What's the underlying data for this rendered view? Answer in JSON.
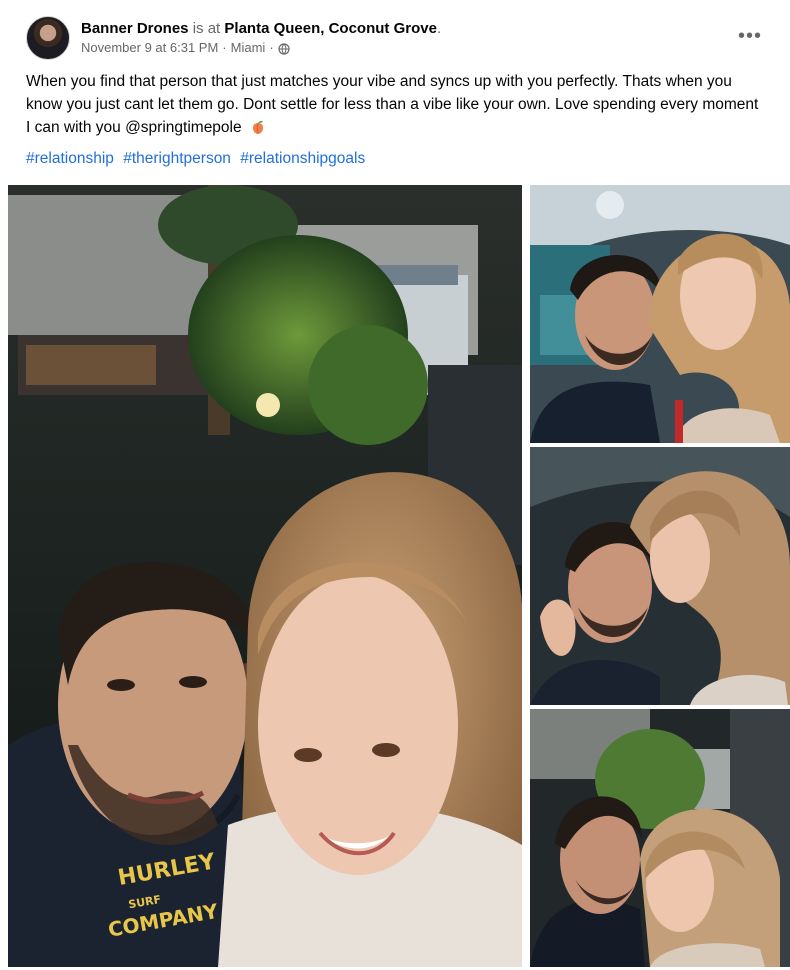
{
  "post": {
    "author": "Banner Drones",
    "is_at": "is at",
    "place": "Planta Queen, Coconut Grove",
    "period": ".",
    "timestamp": "November 9 at 6:31 PM",
    "separator": "·",
    "location": "Miami",
    "audience_icon": "globe-icon",
    "more_label": "•••",
    "text": "When you find that person that just matches your vibe and syncs up with you perfectly. Thats when you know you just cant let them go. Dont settle for less than a vibe like your own. Love spending every moment I can with you @springtimepole",
    "emoji": "peach-emoji",
    "hashtags": [
      "#relationship",
      "#therightperson",
      "#relationshipgoals"
    ],
    "shirt_text": [
      "HURLEY",
      "SURF",
      "COMPANY"
    ]
  },
  "colors": {
    "link": "#216fdb",
    "secondary_text": "#65676b",
    "primary_text": "#050505"
  }
}
